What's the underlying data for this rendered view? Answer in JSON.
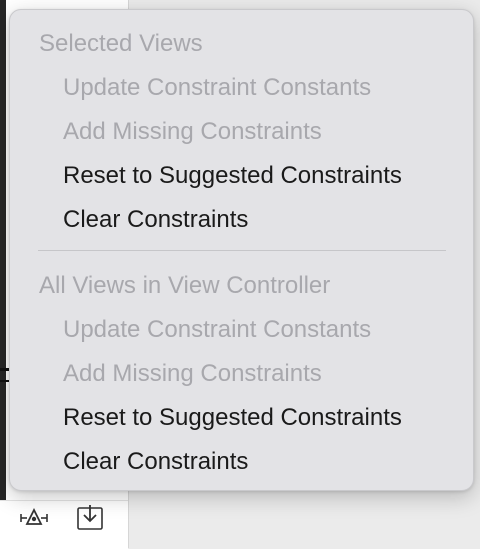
{
  "menu": {
    "sections": [
      {
        "header": "Selected Views",
        "items": [
          {
            "label": "Update Constraint Constants",
            "enabled": false
          },
          {
            "label": "Add Missing Constraints",
            "enabled": false
          },
          {
            "label": "Reset to Suggested Constraints",
            "enabled": true
          },
          {
            "label": "Clear Constraints",
            "enabled": true
          }
        ]
      },
      {
        "header": "All Views in View Controller",
        "items": [
          {
            "label": "Update Constraint Constants",
            "enabled": false
          },
          {
            "label": "Add Missing Constraints",
            "enabled": false
          },
          {
            "label": "Reset to Suggested Constraints",
            "enabled": true
          },
          {
            "label": "Clear Constraints",
            "enabled": true
          }
        ]
      }
    ]
  },
  "toolbar": {
    "icons": [
      "resolve-autolayout-icon",
      "embed-in-icon"
    ]
  },
  "colors": {
    "menu_background": "#e3e3e6",
    "disabled_text": "#a8a8ad",
    "enabled_text": "#1a1a1a"
  }
}
